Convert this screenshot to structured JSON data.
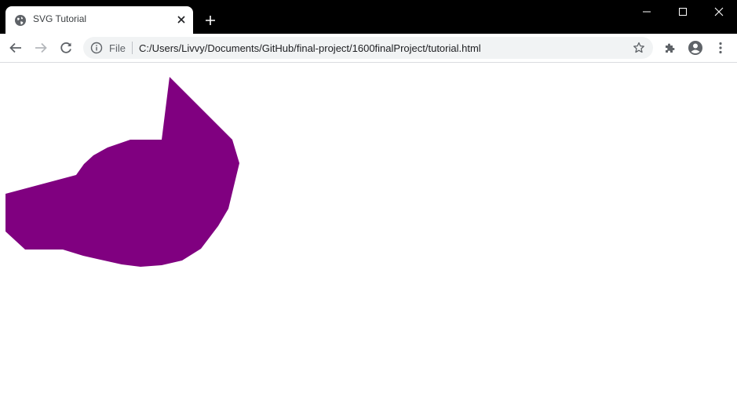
{
  "tab": {
    "title": "SVG Tutorial",
    "favicon": "globe-icon"
  },
  "toolbar": {
    "scheme_label": "File",
    "url": "C:/Users/Livvy/Documents/GitHub/final-project/1600finalProject/tutorial.html"
  },
  "page": {
    "shape_color": "#800080"
  }
}
